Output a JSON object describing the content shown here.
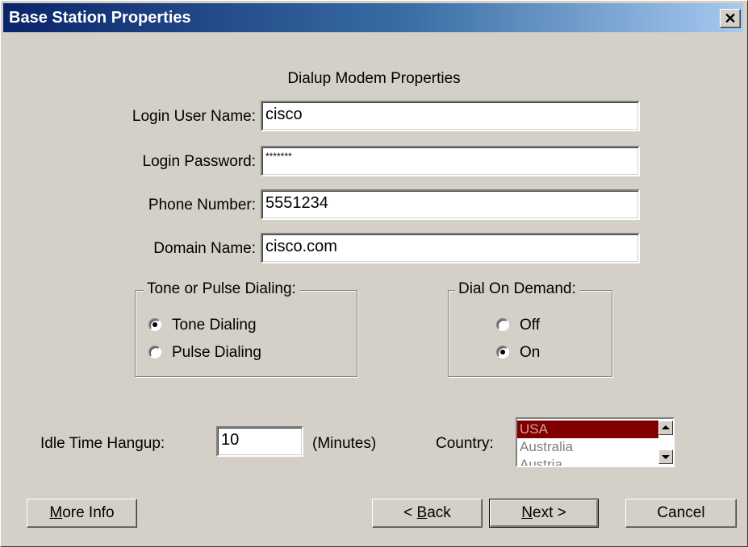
{
  "window": {
    "title": "Base Station Properties",
    "close_glyph": "✕"
  },
  "heading": "Dialup Modem Properties",
  "fields": [
    {
      "label": "Login User Name:",
      "value": "cisco"
    },
    {
      "label": "Login Password:",
      "value": "*******"
    },
    {
      "label": "Phone Number:",
      "value": "5551234"
    },
    {
      "label": "Domain Name:",
      "value": "cisco.com"
    }
  ],
  "dialing_group": {
    "legend": "Tone or Pulse Dialing:",
    "options": [
      {
        "label": "Tone Dialing",
        "selected": true
      },
      {
        "label": "Pulse Dialing",
        "selected": false
      }
    ]
  },
  "demand_group": {
    "legend": "Dial On Demand:",
    "options": [
      {
        "label": "Off",
        "selected": false
      },
      {
        "label": "On",
        "selected": true
      }
    ]
  },
  "idle": {
    "label": "Idle Time Hangup:",
    "value": "10",
    "unit": "(Minutes)"
  },
  "country": {
    "label": "Country:",
    "options": [
      "USA",
      "Australia",
      "Austria"
    ],
    "selected": "USA"
  },
  "buttons": {
    "more_info": {
      "underline": "M",
      "rest": "ore Info"
    },
    "back": {
      "prefix": "< ",
      "underline": "B",
      "rest": "ack"
    },
    "next": {
      "underline": "N",
      "rest": "ext >"
    },
    "cancel": "Cancel"
  }
}
